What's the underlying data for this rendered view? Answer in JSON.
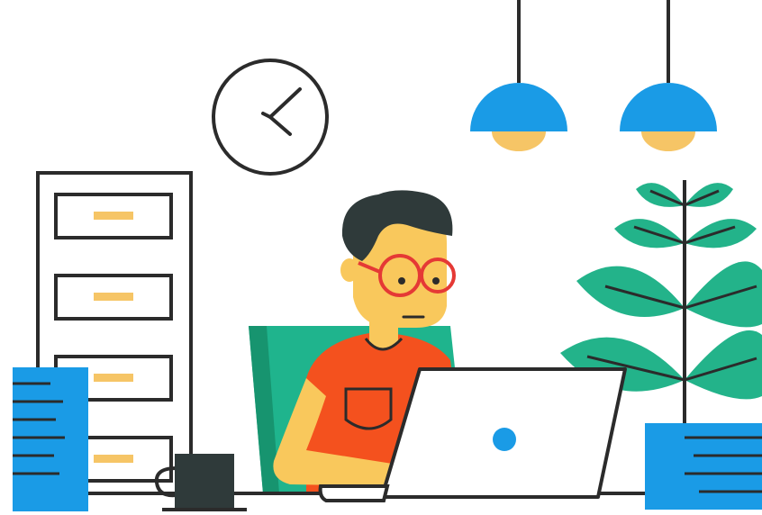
{
  "scene": {
    "objects": {
      "wall_clock": {
        "icon": "clock-icon"
      },
      "pendant_lamps": {
        "count": 2,
        "icon": "lamp-icon"
      },
      "filing_cabinet": {
        "drawers": 4,
        "icon": "cabinet-icon"
      },
      "plant": {
        "icon": "plant-icon"
      },
      "person": {
        "icon": "person-icon"
      },
      "laptop": {
        "icon": "laptop-icon"
      },
      "coffee_mug": {
        "icon": "mug-icon"
      },
      "document_stacks": {
        "count": 2,
        "icon": "document-icon"
      }
    }
  },
  "palette": {
    "outline": "#2b2b2b",
    "background": "#ffffff",
    "lamp_blue": "#1a9be6",
    "lamp_light": "#f6c566",
    "plant_green": "#23b38a",
    "chair_green": "#1fb48d",
    "shirt_red": "#f4511e",
    "skin": "#f9c85c",
    "hair": "#2f3a3a",
    "glasses": "#e53935",
    "drawer_handle": "#f6c566",
    "doc_blue": "#1a9be6",
    "laptop_dot": "#1a9be6"
  }
}
